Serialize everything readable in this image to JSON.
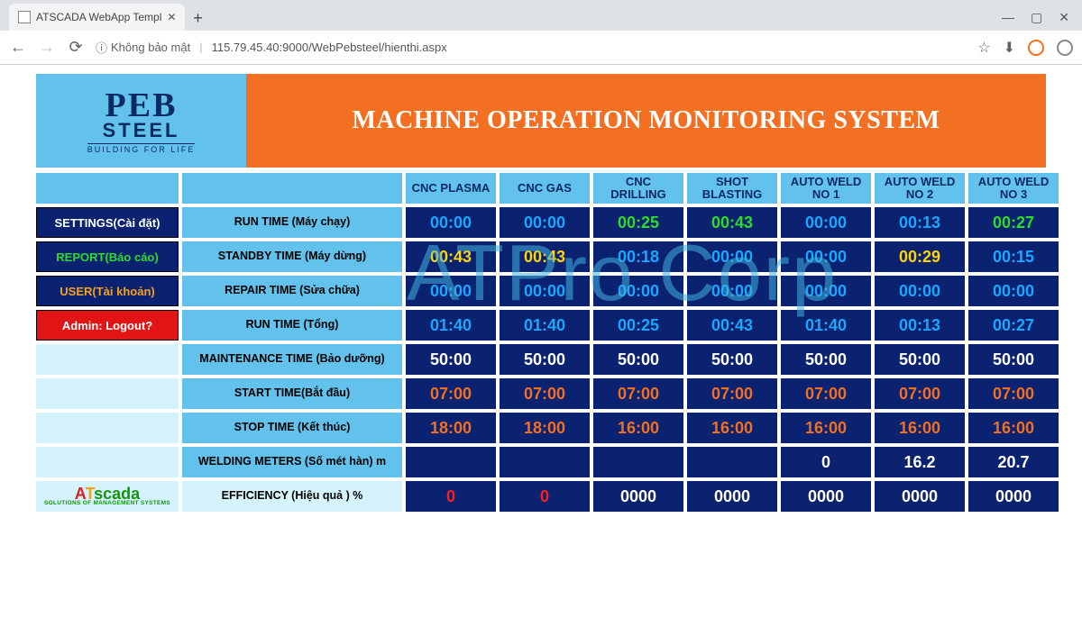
{
  "browser": {
    "tab_title": "ATSCADA WebApp Templ",
    "insecure_label": "Không bảo mật",
    "url": "115.79.45.40:9000/WebPebsteel/hienthi.aspx"
  },
  "logo": {
    "line1": "PEB",
    "line2": "STEEL",
    "line3": "BUILDING FOR LIFE"
  },
  "title": "MACHINE OPERATION MONITORING SYSTEM",
  "watermark": "ATPro Corp",
  "sidebar": {
    "settings": "SETTINGS(Cài đặt)",
    "report": "REPORT(Báo cáo)",
    "user": "USER(Tài khoản)",
    "logout": "Admin: Logout?"
  },
  "columns": [
    "CNC PLASMA",
    "CNC GAS",
    "CNC DRILLING",
    "SHOT BLASTING",
    "AUTO WELD NO 1",
    "AUTO WELD NO 2",
    "AUTO WELD NO 3"
  ],
  "rows": [
    {
      "label": "RUN TIME (Máy chạy)",
      "colors": [
        "blue",
        "blue",
        "green",
        "green",
        "blue",
        "blue",
        "green"
      ],
      "values": [
        "00:00",
        "00:00",
        "00:25",
        "00:43",
        "00:00",
        "00:13",
        "00:27"
      ]
    },
    {
      "label": "STANDBY TIME (Máy dừng)",
      "colors": [
        "yellow",
        "yellow",
        "blue",
        "blue",
        "blue",
        "yellow",
        "blue"
      ],
      "values": [
        "00:43",
        "00:43",
        "00:18",
        "00:00",
        "00:00",
        "00:29",
        "00:15"
      ]
    },
    {
      "label": "REPAIR TIME (Sửa chữa)",
      "colors": [
        "blue",
        "blue",
        "blue",
        "blue",
        "blue",
        "blue",
        "blue"
      ],
      "values": [
        "00:00",
        "00:00",
        "00:00",
        "00:00",
        "00:00",
        "00:00",
        "00:00"
      ]
    },
    {
      "label": "RUN TIME (Tổng)",
      "colors": [
        "blue",
        "blue",
        "blue",
        "blue",
        "blue",
        "blue",
        "blue"
      ],
      "values": [
        "01:40",
        "01:40",
        "00:25",
        "00:43",
        "01:40",
        "00:13",
        "00:27"
      ]
    },
    {
      "label": "MAINTENANCE TIME (Bảo dưỡng)",
      "colors": [
        "white",
        "white",
        "white",
        "white",
        "white",
        "white",
        "white"
      ],
      "values": [
        "50:00",
        "50:00",
        "50:00",
        "50:00",
        "50:00",
        "50:00",
        "50:00"
      ]
    },
    {
      "label": "START TIME(Bắt đầu)",
      "colors": [
        "orange",
        "orange",
        "orange",
        "orange",
        "orange",
        "orange",
        "orange"
      ],
      "values": [
        "07:00",
        "07:00",
        "07:00",
        "07:00",
        "07:00",
        "07:00",
        "07:00"
      ]
    },
    {
      "label": "STOP TIME (Kết thúc)",
      "colors": [
        "orange",
        "orange",
        "orange",
        "orange",
        "orange",
        "orange",
        "orange"
      ],
      "values": [
        "18:00",
        "18:00",
        "16:00",
        "16:00",
        "16:00",
        "16:00",
        "16:00"
      ]
    },
    {
      "label": "WELDING METERS (Số mét hàn) m",
      "colors": [
        "empty",
        "empty",
        "empty",
        "empty",
        "white",
        "white",
        "white"
      ],
      "values": [
        "",
        "",
        "",
        "",
        "0",
        "16.2",
        "20.7"
      ]
    },
    {
      "label": "EFFICIENCY (Hiệu quả ) %",
      "colors": [
        "red",
        "red",
        "white",
        "white",
        "white",
        "white",
        "white"
      ],
      "values": [
        "0",
        "0",
        "0000",
        "0000",
        "0000",
        "0000",
        "0000"
      ],
      "eff": true
    }
  ],
  "atscada": {
    "brand": "ATscada",
    "sub": "SOLUTIONS OF MANAGEMENT SYSTEMS"
  }
}
